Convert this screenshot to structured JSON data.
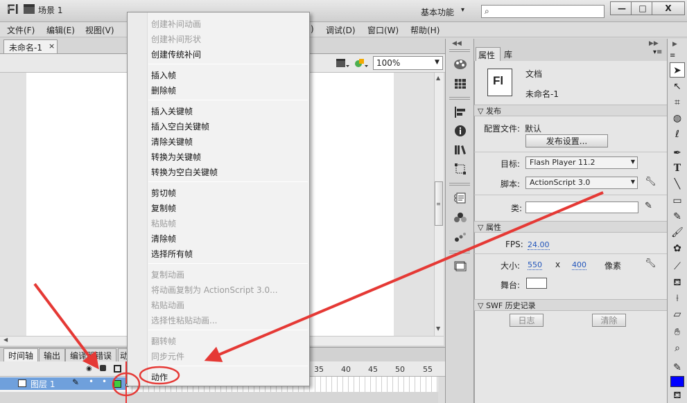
{
  "app": {
    "logo": "Fl",
    "workspace": "基本功能",
    "search_placeholder": ""
  },
  "window_buttons": {
    "minimize": "—",
    "maximize": "□",
    "close": "X"
  },
  "menu": [
    "文件(F)",
    "编辑(E)",
    "视图(V)",
    "",
    "调试(D)",
    "窗口(W)",
    "帮助(H)"
  ],
  "menu_hidden_fragment": ")",
  "document": {
    "tab_label": "未命名-1",
    "tab_close": "×",
    "scene_label": "场景 1",
    "zoom": "100%"
  },
  "context_menu": {
    "items": [
      {
        "label": "创建补间动画",
        "enabled": false
      },
      {
        "label": "创建补间形状",
        "enabled": false
      },
      {
        "label": "创建传统补间",
        "enabled": true
      },
      {
        "label": "插入帧",
        "enabled": true
      },
      {
        "label": "删除帧",
        "enabled": true
      },
      {
        "label": "插入关键帧",
        "enabled": true
      },
      {
        "label": "插入空白关键帧",
        "enabled": true
      },
      {
        "label": "清除关键帧",
        "enabled": true
      },
      {
        "label": "转换为关键帧",
        "enabled": true
      },
      {
        "label": "转换为空白关键帧",
        "enabled": true
      },
      {
        "label": "剪切帧",
        "enabled": true
      },
      {
        "label": "复制帧",
        "enabled": true
      },
      {
        "label": "粘贴帧",
        "enabled": false
      },
      {
        "label": "清除帧",
        "enabled": true
      },
      {
        "label": "选择所有帧",
        "enabled": true
      },
      {
        "label": "复制动画",
        "enabled": false
      },
      {
        "label": "将动画复制为 ActionScript 3.0...",
        "enabled": false
      },
      {
        "label": "粘贴动画",
        "enabled": false
      },
      {
        "label": "选择性粘贴动画...",
        "enabled": false
      },
      {
        "label": "翻转帧",
        "enabled": false
      },
      {
        "label": "同步元件",
        "enabled": false
      },
      {
        "label": "动作",
        "enabled": true
      }
    ]
  },
  "timeline": {
    "tabs": [
      "时间轴",
      "输出",
      "编译器错误"
    ],
    "tab_fragment": "动",
    "layer_name": "图层 1",
    "frame_numbers": [
      "35",
      "40",
      "45",
      "50",
      "55"
    ]
  },
  "properties": {
    "tabs": {
      "properties": "属性",
      "library": "库"
    },
    "doc_icon": "Fl",
    "doc_type": "文档",
    "doc_name": "未命名-1",
    "publish": {
      "section": "发布",
      "profile_label": "配置文件:",
      "profile_value": "默认",
      "settings_button": "发布设置...",
      "target_label": "目标:",
      "target_value": "Flash Player 11.2",
      "script_label": "脚本:",
      "script_value": "ActionScript 3.0",
      "class_label": "类:",
      "class_value": ""
    },
    "props": {
      "section": "属性",
      "fps_label": "FPS:",
      "fps_value": "24.00",
      "size_label": "大小:",
      "width": "550",
      "x": "x",
      "height": "400",
      "unit": "像素",
      "stage_label": "舞台:"
    },
    "swf": {
      "section": "SWF 历史记录",
      "log_button": "日志",
      "clear_button": "清除"
    }
  },
  "colors": {
    "stage": "#ffffff",
    "stroke_color": "#0000ff",
    "layer_highlight": "#6fa0dc",
    "annotation": "#e53935"
  }
}
